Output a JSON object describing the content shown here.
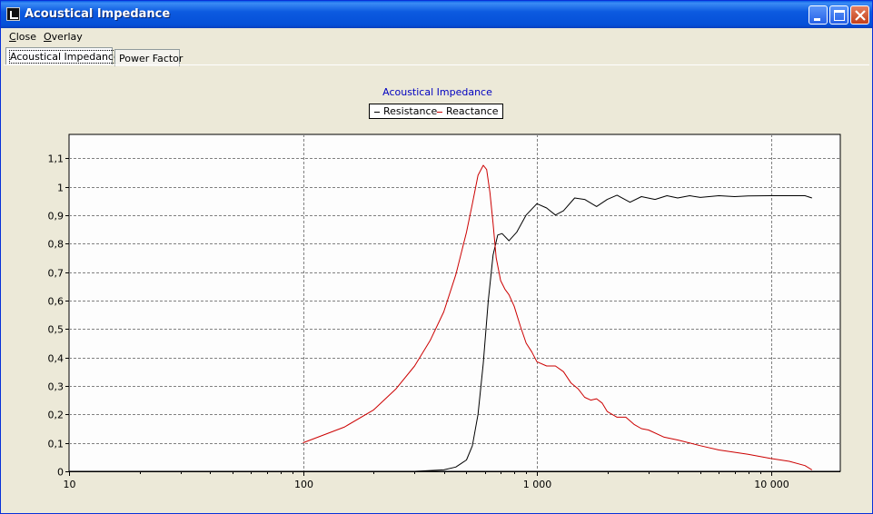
{
  "window": {
    "title": "Acoustical Impedance",
    "controls": [
      "minimize",
      "maximize",
      "close"
    ]
  },
  "menu": [
    {
      "label": "Close",
      "accel": "C"
    },
    {
      "label": "Overlay",
      "accel": "O"
    }
  ],
  "tabs": [
    {
      "label": "Acoustical Impedance",
      "active": true
    },
    {
      "label": "Power Factor",
      "active": false
    }
  ],
  "colors": {
    "resistance": "#000000",
    "reactance": "#cc0000",
    "title": "#0000c0"
  },
  "chart_data": {
    "type": "line",
    "title": "Acoustical Impedance",
    "x_scale": "log",
    "xlim": [
      10,
      20000
    ],
    "ylim": [
      0,
      1.19
    ],
    "grid": true,
    "legend": "top-center",
    "x_ticks": [
      "10",
      "100",
      "1 000",
      "10 000"
    ],
    "x_tick_values": [
      10,
      100,
      1000,
      10000
    ],
    "y_ticks": [
      "0",
      "0,1",
      "0,2",
      "0,3",
      "0,4",
      "0,5",
      "0,6",
      "0,7",
      "0,8",
      "0,9",
      "1",
      "1,1"
    ],
    "y_tick_values": [
      0,
      0.1,
      0.2,
      0.3,
      0.4,
      0.5,
      0.6,
      0.7,
      0.8,
      0.9,
      1.0,
      1.1
    ],
    "series": [
      {
        "name": "Resistance",
        "color": "#000000",
        "x": [
          100,
          300,
          400,
          450,
          500,
          530,
          560,
          590,
          620,
          650,
          680,
          710,
          760,
          820,
          900,
          1000,
          1100,
          1200,
          1300,
          1450,
          1600,
          1800,
          2000,
          2200,
          2500,
          2800,
          3200,
          3600,
          4000,
          4500,
          5000,
          6000,
          7000,
          8000,
          10000,
          12000,
          14000,
          15000
        ],
        "y": [
          0,
          0,
          0.005,
          0.015,
          0.04,
          0.09,
          0.2,
          0.38,
          0.6,
          0.76,
          0.83,
          0.835,
          0.81,
          0.84,
          0.9,
          0.94,
          0.925,
          0.9,
          0.915,
          0.96,
          0.955,
          0.93,
          0.955,
          0.97,
          0.945,
          0.965,
          0.955,
          0.968,
          0.96,
          0.968,
          0.962,
          0.968,
          0.965,
          0.967,
          0.968,
          0.968,
          0.968,
          0.96
        ]
      },
      {
        "name": "Reactance",
        "color": "#cc0000",
        "x": [
          100,
          150,
          200,
          250,
          300,
          350,
          400,
          450,
          500,
          530,
          560,
          590,
          610,
          630,
          650,
          670,
          700,
          730,
          760,
          800,
          850,
          900,
          950,
          1000,
          1100,
          1200,
          1300,
          1400,
          1500,
          1600,
          1700,
          1800,
          1900,
          2000,
          2200,
          2400,
          2600,
          2800,
          3000,
          3500,
          4000,
          5000,
          6000,
          8000,
          10000,
          12000,
          14000,
          15000
        ],
        "y": [
          0.1,
          0.155,
          0.215,
          0.29,
          0.37,
          0.46,
          0.56,
          0.69,
          0.84,
          0.94,
          1.04,
          1.075,
          1.06,
          0.98,
          0.87,
          0.75,
          0.67,
          0.64,
          0.62,
          0.58,
          0.51,
          0.45,
          0.42,
          0.385,
          0.37,
          0.37,
          0.35,
          0.31,
          0.29,
          0.26,
          0.25,
          0.255,
          0.24,
          0.21,
          0.19,
          0.19,
          0.165,
          0.15,
          0.145,
          0.12,
          0.11,
          0.09,
          0.075,
          0.06,
          0.045,
          0.035,
          0.02,
          0.005
        ]
      }
    ]
  }
}
